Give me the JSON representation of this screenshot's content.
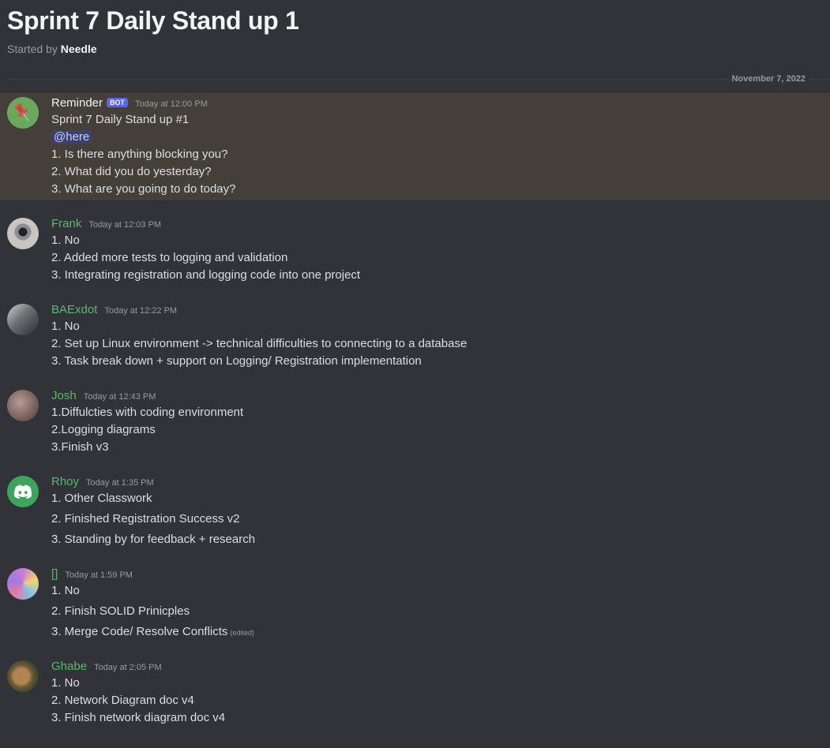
{
  "thread": {
    "title": "Sprint 7 Daily Stand up 1",
    "started_by_prefix": "Started by",
    "started_by_name": "Needle"
  },
  "date_divider": "November 7, 2022",
  "colors": {
    "username_green": "#57bb68",
    "username_white": "#f2f3f5",
    "mention_bg": "#444039",
    "bot_tag": "#5865f2"
  },
  "messages": [
    {
      "author": "Reminder",
      "bot_tag": "BOT",
      "time": "Today at 12:00 PM",
      "avatar_icon": "pushpin-icon",
      "lines": [
        "Sprint 7 Daily Stand up #1",
        "@here",
        "1. Is there anything blocking you?",
        "2. What did you do yesterday?",
        "3. What are you going to do today?"
      ]
    },
    {
      "author": "Frank",
      "time": "Today at 12:03 PM",
      "lines": [
        "1. No",
        "2. Added more tests to logging and validation",
        "3. Integrating registration and logging code into one project"
      ]
    },
    {
      "author": "BAExdot",
      "time": "Today at 12:22 PM",
      "lines": [
        "1. No",
        "2. Set up Linux environment -> technical difficulties to connecting to a database",
        "3. Task break down + support on Logging/ Registration implementation"
      ]
    },
    {
      "author": "Josh",
      "time": "Today at 12:43 PM",
      "lines": [
        "1.Diffulcties with coding environment",
        "2.Logging diagrams",
        "3.Finish v3"
      ]
    },
    {
      "author": "Rhoy",
      "time": "Today at 1:35 PM",
      "avatar_icon": "discord-logo-icon",
      "lines": [
        "1. Other Classwork",
        "2. Finished Registration Success v2",
        "3. Standing by for feedback + research"
      ]
    },
    {
      "author": "[]",
      "time": "Today at 1:59 PM",
      "lines": [
        "1. No",
        "2. Finish SOLID Prinicples",
        "3. Merge Code/ Resolve Conflicts"
      ],
      "edited": "(edited)"
    },
    {
      "author": "Ghabe",
      "time": "Today at 2:05 PM",
      "lines": [
        "1. No",
        "2. Network Diagram doc v4",
        "3. Finish network diagram doc  v4"
      ]
    }
  ]
}
